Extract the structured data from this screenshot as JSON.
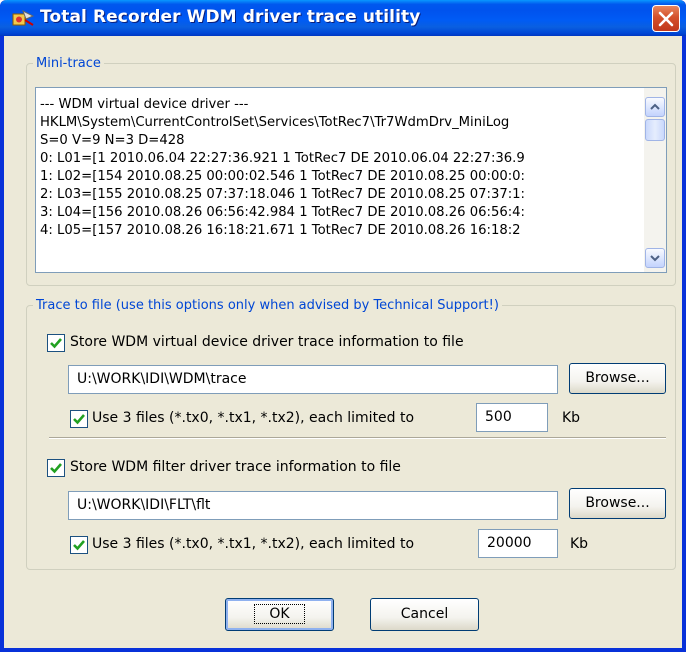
{
  "window": {
    "title": "Total Recorder WDM driver trace utility",
    "title_icon": "recorder-app-icon",
    "close_icon": "close-icon"
  },
  "mini_trace": {
    "legend": "Mini-trace",
    "lines": [
      "--- WDM virtual device driver ---",
      "HKLM\\System\\CurrentControlSet\\Services\\TotRec7\\Tr7WdmDrv_MiniLog",
      "S=0 V=9 N=3 D=428",
      "0: L01=[1 2010.06.04 22:27:36.921 1 TotRec7 DE 2010.06.04 22:27:36.9",
      "1: L02=[154 2010.08.25 00:00:02.546 1 TotRec7 DE 2010.08.25 00:00:0:",
      "2: L03=[155 2010.08.25 07:37:18.046 1 TotRec7 DE 2010.08.25 07:37:1:",
      "3: L04=[156 2010.08.26 06:56:42.984 1 TotRec7 DE 2010.08.26 06:56:4:",
      "4: L05=[157 2010.08.26 16:18:21.671 1 TotRec7 DE 2010.08.26 16:18:2"
    ]
  },
  "trace_to_file": {
    "legend": "Trace to file (use this options only when advised by Technical Support!)",
    "virtual": {
      "store_label": "Store WDM virtual device driver trace information to file",
      "store_checked": true,
      "path": "U:\\WORK\\IDI\\WDM\\trace",
      "browse_label": "Browse...",
      "use3_label": "Use 3 files (*.tx0, *.tx1, *.tx2), each limited to",
      "use3_checked": true,
      "limit": "500",
      "unit": "Kb"
    },
    "filter": {
      "store_label": "Store WDM filter driver trace information to file",
      "store_checked": true,
      "path": "U:\\WORK\\IDI\\FLT\\flt",
      "browse_label": "Browse...",
      "use3_label": "Use 3 files (*.tx0, *.tx1, *.tx2), each limited to",
      "use3_checked": true,
      "limit": "20000",
      "unit": "Kb"
    }
  },
  "buttons": {
    "ok": "OK",
    "cancel": "Cancel"
  },
  "colors": {
    "titlebar": "#0058ee",
    "dialog_bg": "#ece9d8",
    "legend_text": "#0046d5",
    "checkmark": "#21a121"
  }
}
